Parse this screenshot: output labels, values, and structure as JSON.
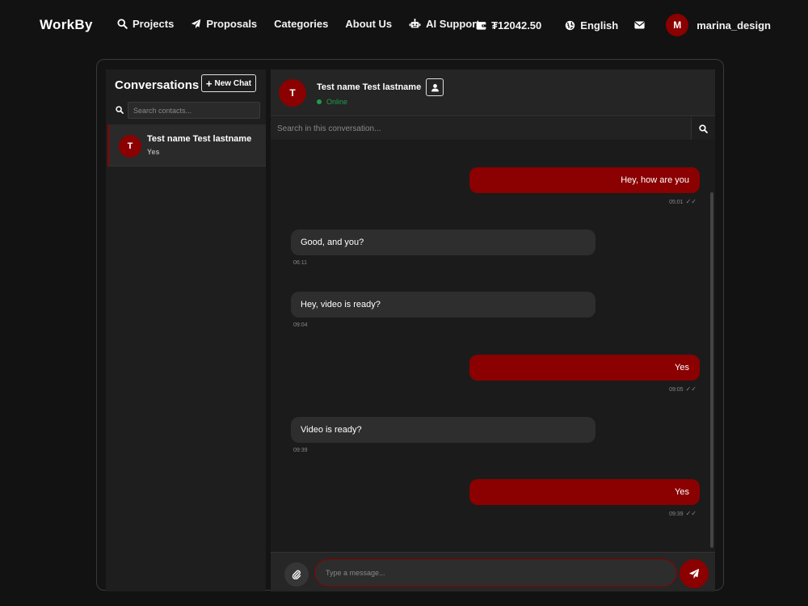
{
  "nav": {
    "brand": "WorkBy",
    "links": [
      {
        "label": "Projects",
        "icon": "search-icon"
      },
      {
        "label": "Proposals",
        "icon": "paper-plane-icon"
      },
      {
        "label": "Categories",
        "icon": ""
      },
      {
        "label": "About Us",
        "icon": ""
      },
      {
        "label": "AI Support",
        "icon": "robot-icon"
      }
    ],
    "balance": "₮12042.50",
    "language": "English",
    "user": {
      "initial": "M",
      "name": "marina_design"
    }
  },
  "sidebar": {
    "title": "Conversations",
    "new_chat_label": "New Chat",
    "search_placeholder": "Search contacts...",
    "contacts": [
      {
        "initial": "T",
        "name": "Test name Test lastname",
        "preview": "Yes",
        "active": true
      }
    ]
  },
  "chat": {
    "contact": {
      "initial": "T",
      "name": "Test name Test lastname",
      "status": "Online"
    },
    "search_placeholder": "Search in this conversation...",
    "messages": [
      {
        "direction": "out",
        "text": "Hey, how are you",
        "time": "05:01"
      },
      {
        "direction": "in",
        "text": "Good, and you?",
        "time": "06:11"
      },
      {
        "direction": "in",
        "text": "Hey, video is ready?",
        "time": "09:04"
      },
      {
        "direction": "out",
        "text": "Yes",
        "time": "09:05"
      },
      {
        "direction": "in",
        "text": "Video is ready?",
        "time": "09:39"
      },
      {
        "direction": "out",
        "text": "Yes",
        "time": "09:39"
      }
    ],
    "composer_placeholder": "Type a message..."
  },
  "colors": {
    "accent": "#8b0000",
    "online": "#1e9e4a",
    "background": "#121212"
  }
}
